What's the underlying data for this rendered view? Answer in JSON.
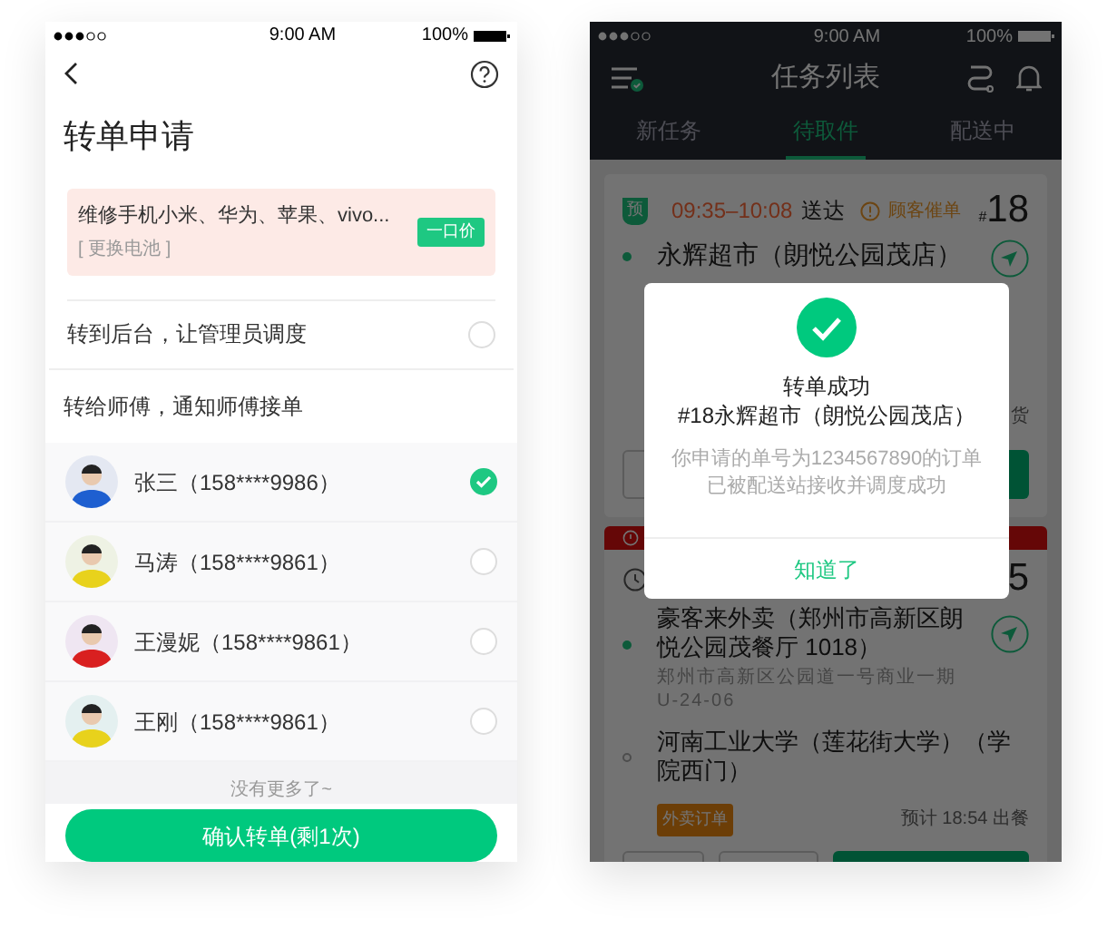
{
  "left_screen": {
    "status_bar": {
      "time": "9:00 AM",
      "battery": "100%"
    },
    "title": "转单申请",
    "order_card": {
      "name": "维修手机小米、华为、苹果、vivo...",
      "service": "[ 更换电池 ]",
      "price_tag": "一口价"
    },
    "dispatch_option": {
      "label": "转到后台，让管理员调度",
      "selected": false
    },
    "workers_heading": "转给师傅，通知师傅接单",
    "workers": [
      {
        "name": "张三（158****9986）",
        "selected": true
      },
      {
        "name": "马涛（158****9861）",
        "selected": false
      },
      {
        "name": "王漫妮（158****9861）",
        "selected": false
      },
      {
        "name": "王刚（158****9861）",
        "selected": false
      }
    ],
    "list_end": "没有更多了~",
    "confirm_button": "确认转单(剩1次)"
  },
  "right_screen": {
    "status_bar": {
      "time": "9:00 AM",
      "battery": "100%"
    },
    "title": "任务列表",
    "tabs": [
      {
        "label": "新任务",
        "selected": false
      },
      {
        "label": "待取件",
        "selected": true
      },
      {
        "label": "配送中",
        "selected": false
      }
    ],
    "order_1": {
      "badge": "预",
      "time_window": "09:35–10:08",
      "time_suffix": "送达",
      "alert": "顾客催单",
      "number_prefix": "#",
      "number": "18",
      "store": "永辉超市（朗悦公园茂店）",
      "note_fragment": "货"
    },
    "order_2": {
      "number": "5",
      "pickup_store": "豪客来外卖（郑州市高新区朗悦公园茂餐厅 1018）",
      "pickup_address": "郑州市高新区公园道一号商业一期 U-24-06",
      "dropoff": "河南工业大学（莲花街大学）（学院西门）",
      "tag": "外卖订单",
      "estimate": "预计 18:54 出餐"
    },
    "dialog": {
      "title": "转单成功",
      "subtitle": "#18永辉超市（朗悦公园茂店）",
      "message_lines": [
        "你申请的单号为1234567890的订单",
        "已被配送站接收并调度成功"
      ],
      "button": "知道了"
    }
  }
}
